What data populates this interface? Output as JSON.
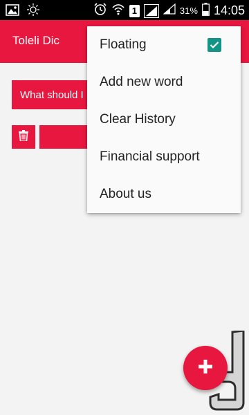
{
  "status_bar": {
    "battery_percent": "31%",
    "time": "14:05",
    "sim_slot": "1"
  },
  "app_bar": {
    "title": "Toleli Dic"
  },
  "content": {
    "question_text": "What should I"
  },
  "menu": {
    "items": [
      {
        "label": "Floating",
        "checked": true
      },
      {
        "label": "Add new word"
      },
      {
        "label": "Clear History"
      },
      {
        "label": "Financial support"
      },
      {
        "label": "About us"
      }
    ]
  },
  "colors": {
    "accent": "#e8173f",
    "check": "#129486"
  }
}
